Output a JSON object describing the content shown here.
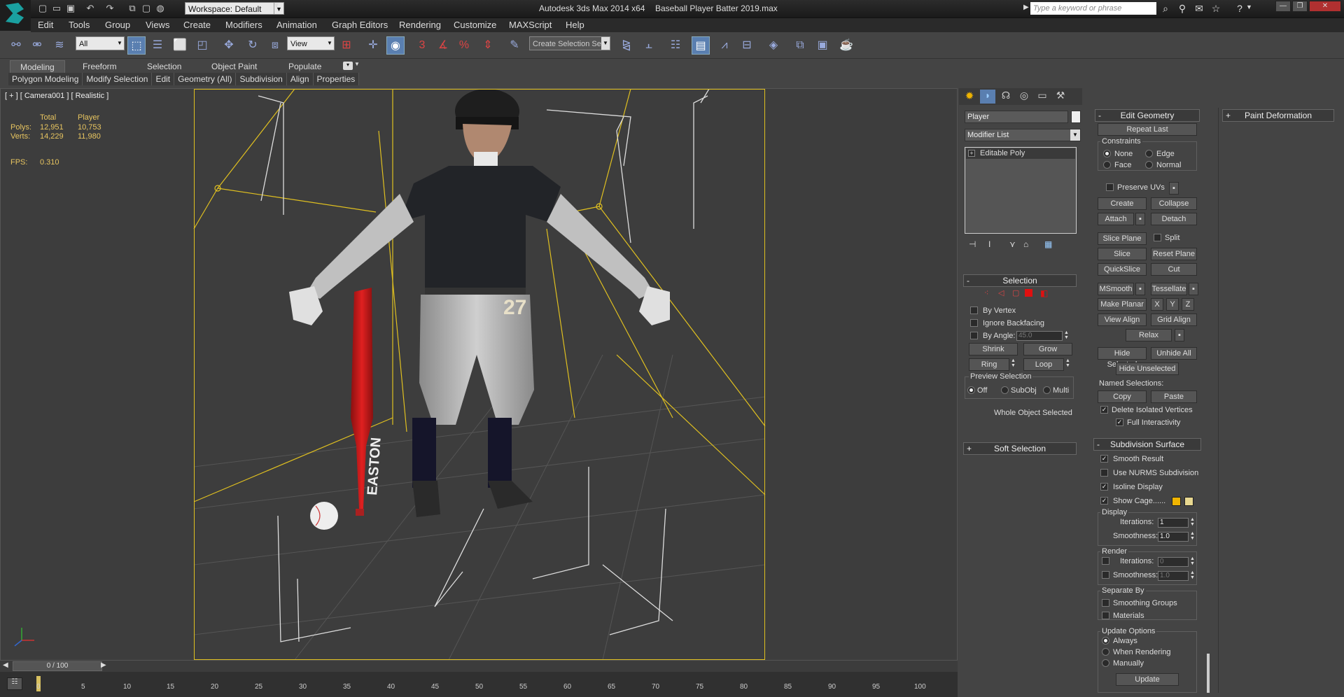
{
  "app": {
    "title": "Autodesk 3ds Max  2014 x64",
    "file": "Baseball Player Batter 2019.max",
    "workspace": "Workspace: Default",
    "search_placeholder": "Type a keyword or phrase"
  },
  "menu": [
    "Edit",
    "Tools",
    "Group",
    "Views",
    "Create",
    "Modifiers",
    "Animation",
    "Graph Editors",
    "Rendering",
    "Customize",
    "MAXScript",
    "Help"
  ],
  "toolbar": {
    "selection_filter": "All",
    "ref_coord": "View",
    "named_selection": "Create Selection Se",
    "snaps": [
      "3",
      "%"
    ]
  },
  "ribbon": {
    "tabs": [
      "Modeling",
      "Freeform",
      "Selection",
      "Object Paint",
      "Populate"
    ],
    "active_tab": "Modeling",
    "subtabs": [
      "Polygon Modeling",
      "Modify Selection",
      "Edit",
      "Geometry (All)",
      "Subdivision",
      "Align",
      "Properties"
    ]
  },
  "viewport": {
    "label": "[ + ] [ Camera001 ] [ Realistic ]",
    "stats": {
      "header_total": "Total",
      "header_obj": "Player",
      "polys_label": "Polys:",
      "polys_total": "12,951",
      "polys_obj": "10,753",
      "verts_label": "Verts:",
      "verts_total": "14,229",
      "verts_obj": "11,980",
      "fps_label": "FPS:",
      "fps_value": "0.310"
    },
    "bat_text": "EASTON",
    "jersey_number": "27"
  },
  "timeline": {
    "slider": "0 / 100",
    "ticks": [
      "0",
      "5",
      "10",
      "15",
      "20",
      "25",
      "30",
      "35",
      "40",
      "45",
      "50",
      "55",
      "60",
      "65",
      "70",
      "75",
      "80",
      "85",
      "90",
      "95",
      "100"
    ]
  },
  "command_panel": {
    "object_name": "Player",
    "modifier_list": "Modifier List",
    "stack_item": "Editable Poly",
    "selection": {
      "title": "Selection",
      "by_vertex": "By Vertex",
      "ignore_backfacing": "Ignore Backfacing",
      "by_angle": "By Angle:",
      "angle_value": "45.0",
      "shrink": "Shrink",
      "grow": "Grow",
      "ring": "Ring",
      "loop": "Loop",
      "preview_selection": "Preview Selection",
      "preview_off": "Off",
      "preview_subobj": "SubObj",
      "preview_multi": "Multi",
      "status": "Whole Object Selected"
    },
    "soft_selection": "Soft Selection"
  },
  "edit_geometry": {
    "title": "Edit Geometry",
    "repeat_last": "Repeat Last",
    "constraints": "Constraints",
    "c_none": "None",
    "c_edge": "Edge",
    "c_face": "Face",
    "c_normal": "Normal",
    "preserve_uvs": "Preserve UVs",
    "create": "Create",
    "collapse": "Collapse",
    "attach": "Attach",
    "detach": "Detach",
    "slice_plane": "Slice Plane",
    "split": "Split",
    "slice": "Slice",
    "reset_plane": "Reset Plane",
    "quickslice": "QuickSlice",
    "cut": "Cut",
    "msmooth": "MSmooth",
    "tessellate": "Tessellate",
    "make_planar": "Make Planar",
    "x": "X",
    "y": "Y",
    "z": "Z",
    "view_align": "View Align",
    "grid_align": "Grid Align",
    "relax": "Relax",
    "hide_selected": "Hide Selected",
    "unhide_all": "Unhide All",
    "hide_unselected": "Hide Unselected",
    "named_selections": "Named Selections:",
    "copy": "Copy",
    "paste": "Paste",
    "delete_isolated": "Delete Isolated Vertices",
    "full_interactivity": "Full Interactivity"
  },
  "subdivision": {
    "title": "Subdivision Surface",
    "smooth_result": "Smooth Result",
    "use_nurms": "Use NURMS Subdivision",
    "isoline": "Isoline Display",
    "show_cage": "Show Cage......",
    "cage_colors": [
      "#f0b400",
      "#e8d890"
    ],
    "display": "Display",
    "iterations_label": "Iterations:",
    "display_iterations": "1",
    "smoothness_label": "Smoothness:",
    "display_smoothness": "1.0",
    "render": "Render",
    "render_iterations": "0",
    "render_smoothness": "1.0",
    "separate_by": "Separate By",
    "smoothing_groups": "Smoothing Groups",
    "materials": "Materials",
    "update_options": "Update Options",
    "always": "Always",
    "when_rendering": "When Rendering",
    "manually": "Manually",
    "update": "Update"
  },
  "paint_deformation": "Paint Deformation"
}
